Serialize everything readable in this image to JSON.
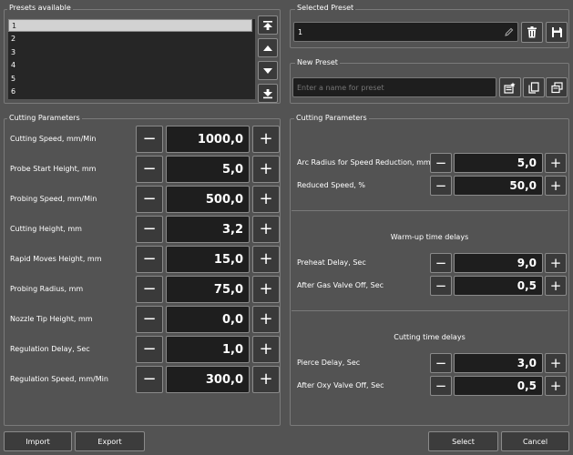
{
  "presets": {
    "title": "Presets available",
    "items": [
      "1",
      "2",
      "3",
      "4",
      "5",
      "6"
    ],
    "selected_index": 0
  },
  "selected_preset": {
    "title": "Selected Preset",
    "value": "1"
  },
  "new_preset": {
    "title": "New Preset",
    "placeholder": "Enter a name for preset"
  },
  "left_params": {
    "title": "Cutting Parameters",
    "rows": [
      {
        "label": "Cutting Speed, mm/Min",
        "value": "1000,0"
      },
      {
        "label": "Probe Start Height, mm",
        "value": "5,0"
      },
      {
        "label": "Probing Speed, mm/Min",
        "value": "500,0"
      },
      {
        "label": "Cutting Height, mm",
        "value": "3,2"
      },
      {
        "label": "Rapid Moves Height, mm",
        "value": "15,0"
      },
      {
        "label": "Probing Radius, mm",
        "value": "75,0"
      },
      {
        "label": "Nozzle Tip Height, mm",
        "value": "0,0"
      },
      {
        "label": "Regulation Delay, Sec",
        "value": "1,0"
      },
      {
        "label": "Regulation Speed, mm/Min",
        "value": "300,0"
      }
    ]
  },
  "right_params": {
    "title": "Cutting Parameters",
    "rows_top": [
      {
        "label": "Arc Radius for Speed Reduction, mm",
        "value": "5,0"
      },
      {
        "label": "Reduced Speed, %",
        "value": "50,0"
      }
    ],
    "warmup_title": "Warm-up time delays",
    "rows_warmup": [
      {
        "label": "Preheat Delay, Sec",
        "value": "9,0"
      },
      {
        "label": "After Gas Valve Off, Sec",
        "value": "0,5"
      }
    ],
    "cutting_title": "Cutting time delays",
    "rows_cutting": [
      {
        "label": "Pierce Delay, Sec",
        "value": "3,0"
      },
      {
        "label": "After Oxy Valve Off, Sec",
        "value": "0,5"
      }
    ]
  },
  "footer": {
    "import_label": "Import",
    "export_label": "Export",
    "select_label": "Select",
    "cancel_label": "Cancel"
  },
  "icons": {
    "minus": "−",
    "plus": "+"
  }
}
